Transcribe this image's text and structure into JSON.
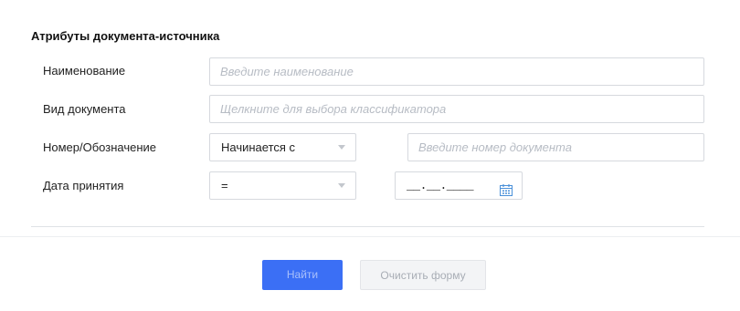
{
  "form": {
    "section_title": "Атрибуты документа-источника",
    "fields": {
      "name": {
        "label": "Наименование",
        "placeholder": "Введите наименование"
      },
      "doc_type": {
        "label": "Вид документа",
        "placeholder": "Щелкните для выбора классификатора"
      },
      "number": {
        "label": "Номер/Обозначение",
        "mode_selected": "Начинается с",
        "placeholder": "Введите номер документа"
      },
      "date": {
        "label": "Дата принятия",
        "operator_selected": "=",
        "mask": "__.__.____"
      }
    }
  },
  "actions": {
    "search_label": "Найти",
    "clear_label": "Очистить форму"
  },
  "icons": {
    "caret": "chevron-down-icon",
    "calendar": "calendar-icon"
  },
  "colors": {
    "primary": "#3b6ff5",
    "calendar_icon": "#4a90d9",
    "border": "#d6d9de",
    "placeholder": "#b7bcc4"
  }
}
